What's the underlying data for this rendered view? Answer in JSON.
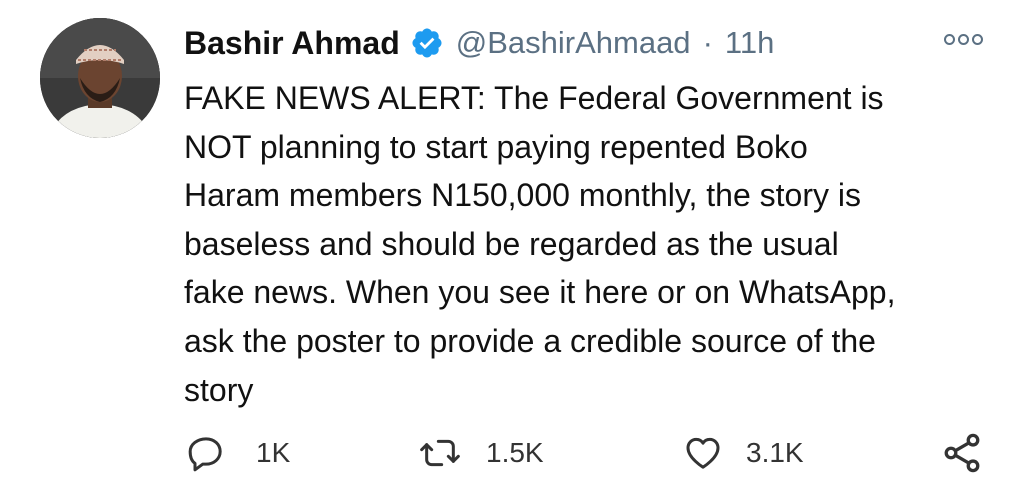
{
  "author": {
    "name": "Bashir Ahmad",
    "handle": "@BashirAhmaad",
    "separator": "·",
    "time": "11h",
    "verified": true
  },
  "tweet": {
    "lines": [
      "FAKE NEWS ALERT: The Federal Government is",
      "NOT planning to start paying repented Boko",
      "Haram members N150,000 monthly, the story is",
      "baseless and should be regarded as the usual",
      "fake news. When you see it here or on WhatsApp,",
      "ask the poster to provide a credible source of the",
      "story"
    ]
  },
  "actions": {
    "reply": {
      "icon": "reply-icon",
      "count": "1K"
    },
    "retweet": {
      "icon": "retweet-icon",
      "count": "1.5K"
    },
    "like": {
      "icon": "heart-icon",
      "count": "3.1K"
    },
    "share": {
      "icon": "share-icon"
    }
  },
  "colors": {
    "verified": "#1d9bf0",
    "muted": "#5b7083",
    "text": "#111111"
  }
}
